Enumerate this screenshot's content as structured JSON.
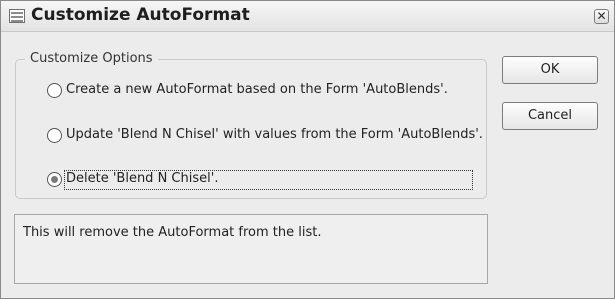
{
  "window": {
    "title": "Customize AutoFormat",
    "title_icon": "autoformat-form-icon",
    "close_glyph": "✕"
  },
  "options_group": {
    "legend": "Customize Options",
    "options": [
      {
        "label": "Create a new AutoFormat based on the Form 'AutoBlends'.",
        "checked": false
      },
      {
        "label": "Update 'Blend N Chisel' with values from the Form 'AutoBlends'.",
        "checked": false
      },
      {
        "label": "Delete 'Blend N Chisel'.",
        "checked": true
      }
    ]
  },
  "buttons": {
    "ok_label": "OK",
    "cancel_label": "Cancel"
  },
  "description": "This will remove the AutoFormat from the list.",
  "colors": {
    "dialog_bg": "#ececec",
    "selected_dot": "#7a7a7a"
  }
}
